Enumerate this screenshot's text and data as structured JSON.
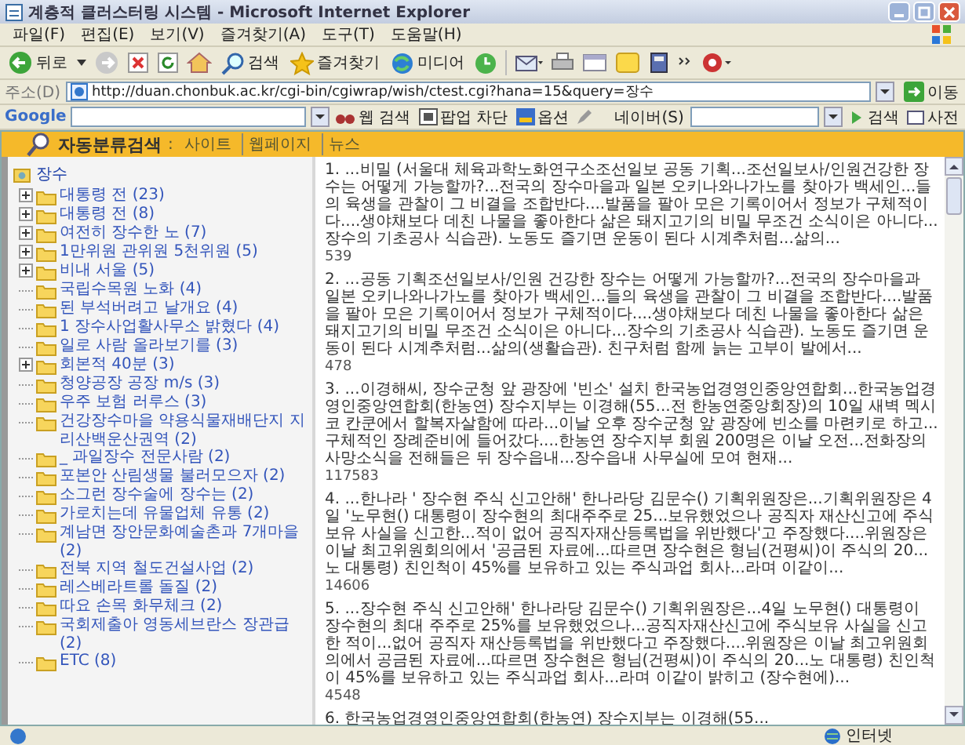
{
  "window": {
    "title": "계층적 클러스터링 시스템 - Microsoft Internet Explorer"
  },
  "menu": [
    "파일(F)",
    "편집(E)",
    "보기(V)",
    "즐겨찾기(A)",
    "도구(T)",
    "도움말(H)"
  ],
  "toolbar": {
    "back": "뒤로",
    "search": "검색",
    "favorites": "즐겨찾기",
    "media": "미디어"
  },
  "address": {
    "label": "주소(D)",
    "value": "http://duan.chonbuk.ac.kr/cgi-bin/cgiwrap/wish/ctest.cgi?hana=15&query=장수",
    "go": "이동"
  },
  "google_bar": {
    "logo": "Google",
    "web_search": "웹 검색",
    "popup_block": "팝업 차단",
    "options": "옵션",
    "naver": "네이버(S)",
    "search": "검색",
    "dictionary": "사전"
  },
  "header": {
    "title": "자동분류검색",
    "prefix": ":",
    "links": [
      "사이트",
      "웹페이지",
      "뉴스"
    ]
  },
  "tree": {
    "root": "장수",
    "children": [
      {
        "label": "대통령 전 (23)",
        "kind": "group"
      },
      {
        "label": "대통령 전 (8)",
        "kind": "group"
      },
      {
        "label": "여전히 장수한 노 (7)",
        "kind": "group"
      },
      {
        "label": "1만위원 관위원 5천위원 (5)",
        "kind": "group"
      },
      {
        "label": "비내 서울 (5)",
        "kind": "group"
      },
      {
        "label": "국립수목원 노화 (4)",
        "kind": "leaf"
      },
      {
        "label": "된 부석버려고 날개요 (4)",
        "kind": "leaf"
      },
      {
        "label": "1 장수사업활사무소 밝혔다 (4)",
        "kind": "leaf"
      },
      {
        "label": "일로 사람 올라보기를 (3)",
        "kind": "leaf"
      },
      {
        "label": "회본적 40분 (3)",
        "kind": "group"
      },
      {
        "label": "청양공장 공장 m/s (3)",
        "kind": "leaf"
      },
      {
        "label": "우주 보험 러루스 (3)",
        "kind": "leaf"
      },
      {
        "label": "건강장수마을 약용식물재배단지 지리산백운산권역 (2)",
        "kind": "leaf"
      },
      {
        "label": "_ 과일장수 전문사람 (2)",
        "kind": "leaf"
      },
      {
        "label": "포본안 산림생물 불러모으자 (2)",
        "kind": "leaf"
      },
      {
        "label": "소그런 장수술에 장수는 (2)",
        "kind": "leaf"
      },
      {
        "label": "가로치는데 유물업체 유통 (2)",
        "kind": "leaf"
      },
      {
        "label": "계남면 장안문화예술촌과 7개마을 (2)",
        "kind": "leaf"
      },
      {
        "label": "전북 지역 철도건설사업 (2)",
        "kind": "leaf"
      },
      {
        "label": "레스베라트롤 돌질 (2)",
        "kind": "leaf"
      },
      {
        "label": "따요 손목 화무체크 (2)",
        "kind": "leaf"
      },
      {
        "label": "국회제출아 영동세브란스 장관급 (2)",
        "kind": "leaf"
      },
      {
        "label": "ETC (8)",
        "kind": "leaf"
      }
    ]
  },
  "results": [
    {
      "number": "1.",
      "snippet": "...비밀 (서울대 체육과학노화연구소조선일보 공동 기획...조선일보사/인원건강한 장수는 어떻게 가능할까?...전국의 장수마을과 일본 오키나와나가노를 찾아가 백세인...들의 육생을 관찰이 그 비결을 조합반다....발품을 팔아 모은 기록이어서 정보가 구체적이다....생야채보다 데친 나물을 좋아한다 삶은 돼지고기의 비밀 무조건 소식이은 아니다...장수의 기초공사 식습관). 노동도 즐기면 운동이 된다 시계추처럼...삶의...",
      "count": "539"
    },
    {
      "number": "2.",
      "snippet": "...공동 기획조선일보사/인원 건강한 장수는 어떻게 가능할까?...전국의 장수마을과 일본 오키나와나가노를 찾아가 백세인...들의 육생을 관찰이 그 비결을 조합반다....발품을 팔아 모은 기록이어서 정보가 구체적이다....생야채보다 데친 나물을 좋아한다 삶은 돼지고기의 비밀 무조건 소식이은 아니다...장수의 기초공사 식습관). 노동도 즐기면 운동이 된다 시계추처럼...삶의(생활습관). 친구처럼 함께 늙는 고부이 발에서...",
      "count": "478"
    },
    {
      "number": "3.",
      "snippet": "...이경해씨, 장수군청 앞 광장에 '빈소' 설치 한국농업경영인중앙연합회...한국농업경영인중앙연합회(한농연) 장수지부는 이경해(55...전 한농연중앙회장)의 10일 새벽 멕시코 칸쿤에서 할복자살함에 따라...이날 오후 장수군청 앞 광장에 빈소를 마련키로 하고...구체적인 장례준비에 들어갔다....한농연 장수지부 회원 200명은 이날 오전...전화장의 사망소식을 전해들은 뒤 장수읍내...장수읍내 사무실에 모여 현재...",
      "count": "117583"
    },
    {
      "number": "4.",
      "snippet": "...한나라 ' 장수현 주식 신고안해' 한나라당 김문수() 기획위원장은...기획위원장은 4일 '노무현() 대통령이 장수현의 최대주주로 25...보유했었으나 공직자 재산신고에 주식보유 사실을 신고한...적이 없어 공직자재산등록법을 위반했다'고 주장했다....위원장은 이날 최고위원회의에서 '공금된 자료에...따르면 장수현은 형님(건평씨)이 주식의 20...노 대통령) 친인척이 45%를 보유하고 있는 주식과업 회사...라며 이같이...",
      "count": "14606"
    },
    {
      "number": "5.",
      "snippet": "...장수현 주식 신고안해' 한나라당 김문수() 기획위원장은...4일 노무현() 대통령이 장수현의 최대 주주로 25%를 보유했었으나...공직자재산신고에 주식보유 사실을 신고한 적이...없어 공직자 재산등록법을 위반했다고 주장했다....위원장은 이날 최고위원회의에서 공금된 자료에...따르면 장수현은 형님(건평씨)이 주식의 20...노 대통령) 친인척이 45%를 보유하고 있는 주식과업 회사...라며 이같이 밝히고 (장수현에)...",
      "count": "4548"
    },
    {
      "number": "6.",
      "snippet": "한국농업경영인중앙연합회(한농연) 장수지부는 이경해(55..."
    }
  ],
  "status_bar": {
    "zone": "인터넷"
  }
}
